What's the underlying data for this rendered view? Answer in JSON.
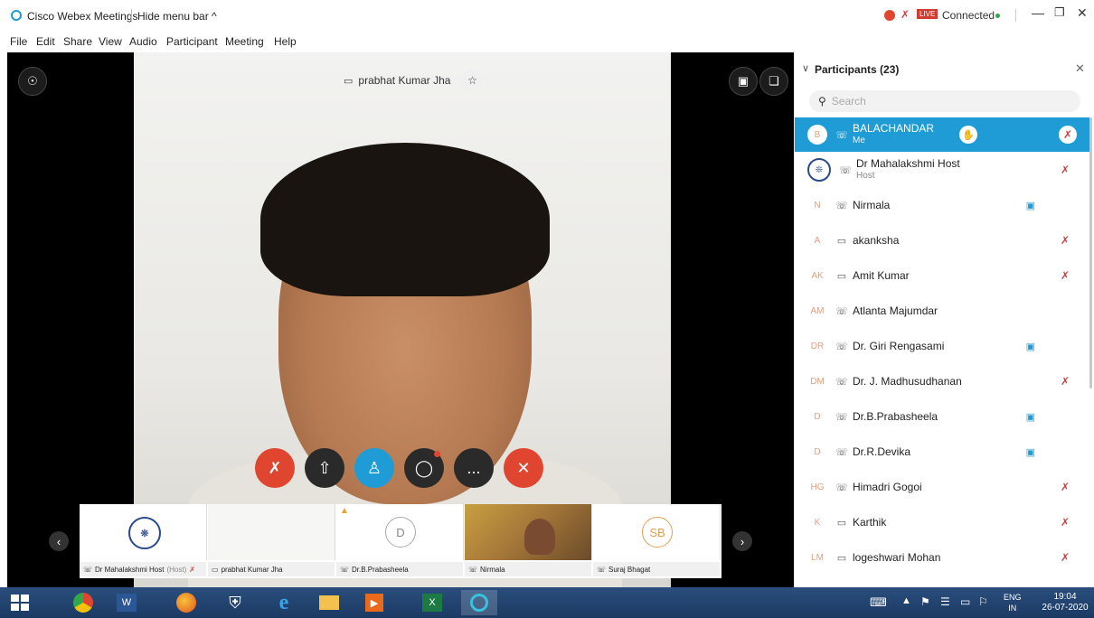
{
  "window": {
    "app_title": "Cisco Webex Meetings",
    "hide_menu_bar": "Hide menu bar ^",
    "status": "Connected",
    "live_badge": "LIVE"
  },
  "menu": [
    "File",
    "Edit",
    "Share",
    "View",
    "Audio",
    "Participant",
    "Meeting",
    "Help"
  ],
  "video": {
    "speaker_name": "prabhat Kumar Jha"
  },
  "controls": [
    {
      "name": "mute",
      "color": "#e0452f"
    },
    {
      "name": "share",
      "color": "#2a2a2a"
    },
    {
      "name": "participants",
      "color": "#1f9cd6"
    },
    {
      "name": "chat",
      "color": "#2a2a2a"
    },
    {
      "name": "more",
      "color": "#2a2a2a",
      "label": "..."
    },
    {
      "name": "leave",
      "color": "#e0452f"
    }
  ],
  "filmstrip": [
    {
      "caption": "Dr Mahalakshmi Host",
      "caption_suffix": "(Host)",
      "avatar": "logo"
    },
    {
      "caption": "prabhat Kumar Jha",
      "avatar": "none"
    },
    {
      "caption": "Dr.B.Prabasheela",
      "avatar": "D"
    },
    {
      "caption": "Nirmala",
      "avatar": "video"
    },
    {
      "caption": "Suraj Bhagat",
      "avatar": "SB"
    }
  ],
  "panel": {
    "title": "Participants (23)",
    "search_placeholder": "Search",
    "participants": [
      {
        "initials": "B",
        "name": "BALACHANDAR",
        "sub": "Me",
        "device": "audio",
        "mic_muted": true,
        "video": false,
        "selected": true
      },
      {
        "initials": "logo",
        "name": "Dr Mahalakshmi Host",
        "sub": "Host",
        "device": "audio",
        "mic_muted": true,
        "video": false
      },
      {
        "initials": "N",
        "name": "Nirmala",
        "device": "audio",
        "mic_muted": false,
        "video": true
      },
      {
        "initials": "A",
        "name": "akanksha",
        "device": "phone",
        "mic_muted": true,
        "video": false
      },
      {
        "initials": "AK",
        "name": "Amit Kumar",
        "device": "phone",
        "mic_muted": true,
        "video": false
      },
      {
        "initials": "AM",
        "name": "Atlanta Majumdar",
        "device": "audio",
        "mic_muted": false,
        "video": false
      },
      {
        "initials": "DR",
        "name": "Dr. Giri Rengasami",
        "device": "audio",
        "mic_muted": false,
        "video": true
      },
      {
        "initials": "DM",
        "name": "Dr. J. Madhusudhanan",
        "device": "audio",
        "mic_muted": true,
        "video": false
      },
      {
        "initials": "D",
        "name": "Dr.B.Prabasheela",
        "device": "audio",
        "mic_muted": false,
        "video": true
      },
      {
        "initials": "D",
        "name": "Dr.R.Devika",
        "device": "audio",
        "mic_muted": false,
        "video": true
      },
      {
        "initials": "HG",
        "name": "Himadri Gogoi",
        "device": "audio",
        "mic_muted": true,
        "video": false
      },
      {
        "initials": "K",
        "name": "Karthik",
        "device": "phone",
        "mic_muted": true,
        "video": false
      },
      {
        "initials": "LM",
        "name": "logeshwari Mohan",
        "device": "phone",
        "mic_muted": true,
        "video": false
      }
    ]
  },
  "taskbar": {
    "language": "ENG",
    "region": "IN",
    "time": "19:04",
    "date": "26-07-2020"
  }
}
